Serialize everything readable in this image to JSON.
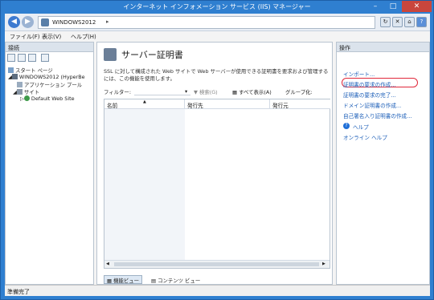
{
  "window": {
    "title": "インターネット インフォメーション サービス (IIS) マネージャー"
  },
  "address": {
    "path": "WINDOWS2012",
    "sep": "▸"
  },
  "menu": {
    "file": "ファイル(F)",
    "view": "表示(V)",
    "help": "ヘルプ(H)"
  },
  "left": {
    "header": "接続",
    "tree": [
      "スタート ページ",
      "WINDOWS2012 (HyperBe",
      "アプリケーション プール",
      "サイト",
      "Default Web Site"
    ]
  },
  "center": {
    "title": "サーバー証明書",
    "description": "SSL に対して構成された Web サイトで Web サーバーが使用できる証明書を要求および管理するには、この機能を使用します。",
    "filter_label": "フィルター:",
    "search": "検索(G)",
    "show_all": "すべて表示(A)",
    "group_by": "グループ化:",
    "columns": [
      "名前",
      "発行先",
      "発行元"
    ],
    "tab_feature": "機能ビュー",
    "tab_content": "コンテンツ ビュー"
  },
  "right": {
    "header": "操作",
    "actions": [
      "インポート...",
      "証明書の要求の作成...",
      "証明書の要求の完了...",
      "ドメイン証明書の作成...",
      "自己署名入り証明書の作成..."
    ],
    "help": "ヘルプ",
    "online_help": "オンライン ヘルプ"
  },
  "status": {
    "text": "準備完了"
  }
}
